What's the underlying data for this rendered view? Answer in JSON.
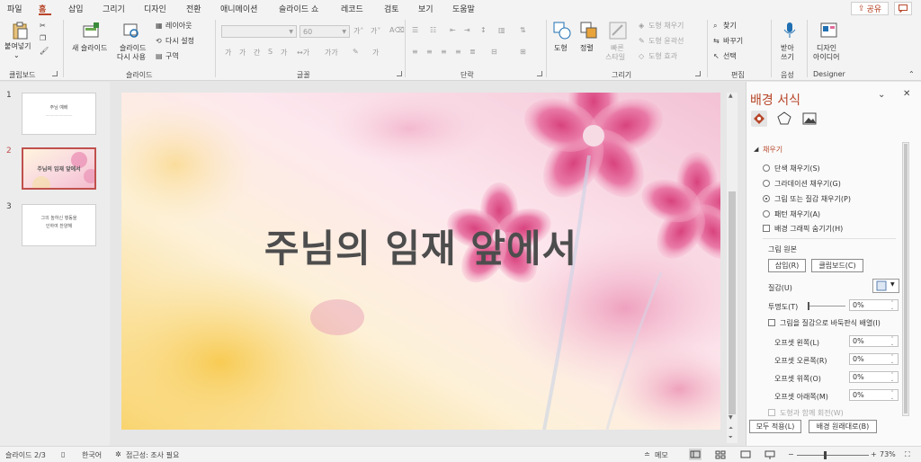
{
  "tabs": [
    "파일",
    "홈",
    "삽입",
    "그리기",
    "디자인",
    "전환",
    "애니메이션",
    "슬라이드 쇼",
    "레코드",
    "검토",
    "보기",
    "도움말"
  ],
  "share_label": "공유",
  "ribbon": {
    "clipboard": {
      "paste": "붙여넣기",
      "label": "클립보드"
    },
    "slides": {
      "new_slide": "새 슬라이드",
      "reuse": "슬라이드",
      "reuse2": "다시 사용",
      "layout": "레이아웃",
      "reset": "다시 설정",
      "section": "구역",
      "label": "슬라이드"
    },
    "font": {
      "size": "60",
      "label": "글꼴"
    },
    "paragraph": {
      "label": "단락"
    },
    "drawing": {
      "shape": "도형",
      "arrange": "정렬",
      "quick_style": "빠른",
      "quick_style2": "스타일",
      "fill": "도형 채우기",
      "outline": "도형 윤곽선",
      "effect": "도형 효과",
      "label": "그리기"
    },
    "editing": {
      "find": "찾기",
      "replace": "바꾸기",
      "select": "선택",
      "label": "편집"
    },
    "voice": {
      "dictate": "받아",
      "dictate2": "쓰기",
      "label": "음성"
    },
    "designer": {
      "ideas": "디자인",
      "ideas2": "아이디어",
      "label": "Designer"
    }
  },
  "thumbnails": [
    {
      "num": "1",
      "title": "주님 예배",
      "sub": "——————"
    },
    {
      "num": "2",
      "title": "주님의 임재 앞에서"
    },
    {
      "num": "3",
      "line1": "그의 높하신 행동을",
      "line2": "인하여 찬양해"
    }
  ],
  "slide": {
    "title": "주님의 임재 앞에서"
  },
  "pane": {
    "title": "배경 서식",
    "section": "채우기",
    "options": [
      "단색 채우기(S)",
      "그라데이션 채우기(G)",
      "그림 또는 질감 채우기(P)",
      "패턴 채우기(A)"
    ],
    "hide_graphics": "배경 그래픽 숨기기(H)",
    "picture_source": "그림 원본",
    "insert": "삽입(R)",
    "clipboard": "클립보드(C)",
    "texture": "질감(U)",
    "transparency": "투명도(T)",
    "transparency_value": "0%",
    "tile": "그림을 질감으로 바둑판식 배열(I)",
    "offset_left": "오프셋 왼쪽(L)",
    "offset_right": "오프셋 오른쪽(R)",
    "offset_top": "오프셋 위쪽(O)",
    "offset_bottom": "오프셋 아래쪽(M)",
    "offset_value": "0%",
    "rotate_with_shape": "도형과 함께 회전(W)",
    "apply_all": "모두 적용(L)",
    "reset_bg": "배경 원래대로(B)"
  },
  "status": {
    "slide_count": "슬라이드 2/3",
    "language": "한국어",
    "accessibility": "접근성: 조사 필요",
    "notes": "메모",
    "zoom": "73%"
  },
  "colors": {
    "accent": "#b7472a",
    "pink": "#e26a9a"
  }
}
